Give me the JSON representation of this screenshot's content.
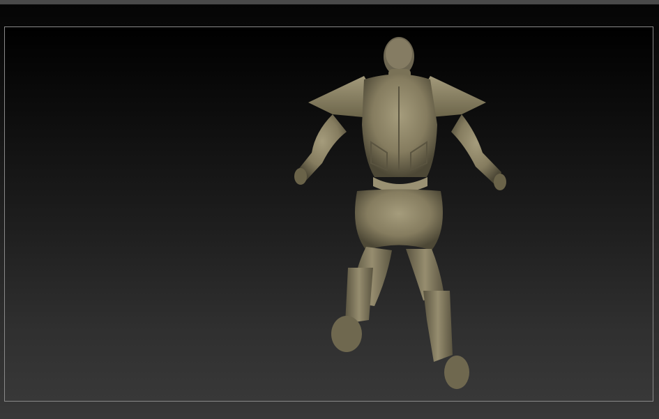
{
  "app": {
    "viewport_label": ""
  },
  "model": {
    "description_icon": "3d-model-icon",
    "color": "#8c8466"
  }
}
